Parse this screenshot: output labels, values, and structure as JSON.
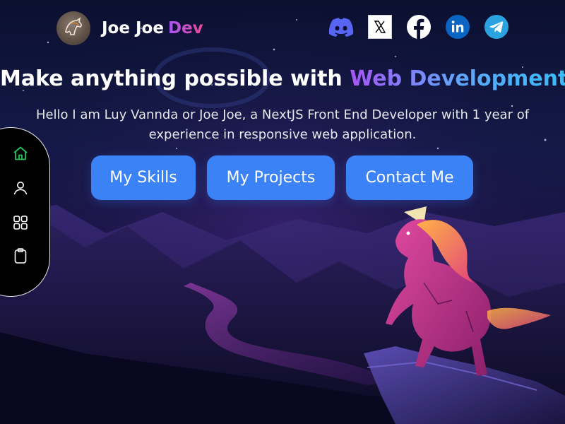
{
  "header": {
    "brand_name": "Joe Joe",
    "brand_accent": "Dev",
    "avatar_icon": "horse-logo-icon",
    "socials": [
      {
        "name": "Discord",
        "icon": "discord-icon",
        "color": "#5865f2"
      },
      {
        "name": "X",
        "icon": "x-icon",
        "color": "#000000"
      },
      {
        "name": "Facebook",
        "icon": "facebook-icon",
        "color": "#ffffff"
      },
      {
        "name": "LinkedIn",
        "icon": "linkedin-icon",
        "color": "#0a66c2"
      },
      {
        "name": "Telegram",
        "icon": "telegram-icon",
        "color": "#2aa3e0"
      }
    ]
  },
  "hero": {
    "title": "Make anything possible with",
    "title_highlight": "Web Development",
    "subtitle": "Hello I am Luy Vannda or Joe Joe, a NextJS Front End Developer with 1 year of experience in responsive web application.",
    "buttons": {
      "skills": "My Skills",
      "projects": "My Projects",
      "contact": "Contact Me"
    }
  },
  "sidenav": {
    "items": [
      {
        "name": "home",
        "icon": "home-icon",
        "active": true
      },
      {
        "name": "about",
        "icon": "user-icon",
        "active": false
      },
      {
        "name": "projects",
        "icon": "grid-icon",
        "active": false
      },
      {
        "name": "resume",
        "icon": "clipboard-icon",
        "active": false
      }
    ]
  },
  "colors": {
    "accent_blue": "#3b82f6",
    "gradient_purple": "#a855f7",
    "gradient_pink": "#ec4899",
    "nav_active": "#22c55e"
  }
}
